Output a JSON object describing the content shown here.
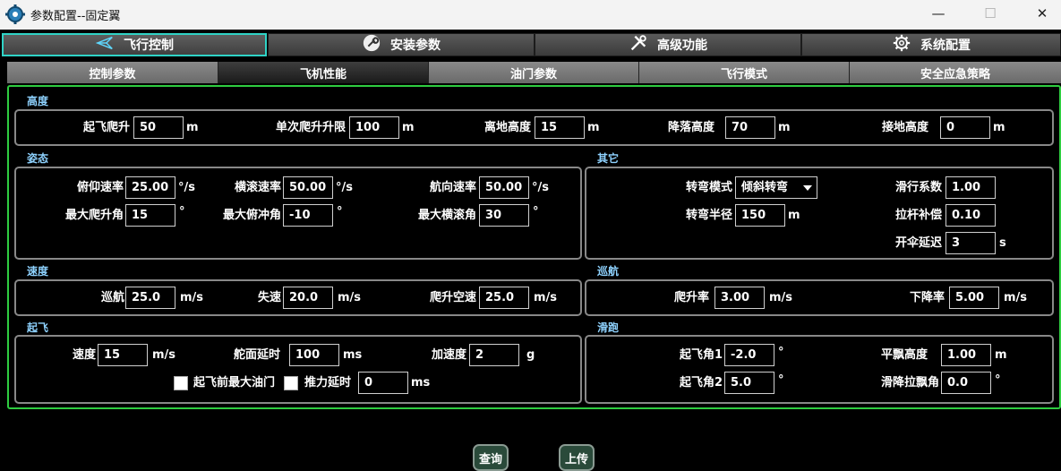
{
  "window": {
    "title": "参数配置--固定翼",
    "minimize": "—",
    "maximize": "☐",
    "close": "✕"
  },
  "main_tabs": [
    {
      "label": "飞行控制",
      "icon": "plane-icon"
    },
    {
      "label": "安装参数",
      "icon": "wrench-icon"
    },
    {
      "label": "高级功能",
      "icon": "tools-icon"
    },
    {
      "label": "系统配置",
      "icon": "gear-icon"
    }
  ],
  "sub_tabs": [
    "控制参数",
    "飞机性能",
    "油门参数",
    "飞行模式",
    "安全应急策略"
  ],
  "altitude": {
    "title": "高度",
    "takeoff_climb": {
      "label": "起飞爬升",
      "value": "50",
      "unit": "m"
    },
    "single_climb_limit": {
      "label": "单次爬升升限",
      "value": "100",
      "unit": "m"
    },
    "ground_clearance": {
      "label": "离地高度",
      "value": "15",
      "unit": "m"
    },
    "landing_height": {
      "label": "降落高度",
      "value": "70",
      "unit": "m"
    },
    "touchdown_height": {
      "label": "接地高度",
      "value": "0",
      "unit": "m"
    }
  },
  "attitude": {
    "title": "姿态",
    "pitch_rate": {
      "label": "俯仰速率",
      "value": "25.00",
      "unit": "°/s"
    },
    "roll_rate": {
      "label": "横滚速率",
      "value": "50.00",
      "unit": "°/s"
    },
    "yaw_rate": {
      "label": "航向速率",
      "value": "50.00",
      "unit": "°/s"
    },
    "max_climb_angle": {
      "label": "最大爬升角",
      "value": "15",
      "unit": "°"
    },
    "max_dive_angle": {
      "label": "最大俯冲角",
      "value": "-10",
      "unit": "°"
    },
    "max_roll_angle": {
      "label": "最大横滚角",
      "value": "30",
      "unit": "°"
    }
  },
  "other": {
    "title": "其它",
    "turn_mode": {
      "label": "转弯模式",
      "value": "倾斜转弯"
    },
    "turn_radius": {
      "label": "转弯半径",
      "value": "150",
      "unit": "m"
    },
    "glide_coef": {
      "label": "滑行系数",
      "value": "1.00"
    },
    "pull_comp": {
      "label": "拉杆补偿",
      "value": "0.10"
    },
    "chute_delay": {
      "label": "开伞延迟",
      "value": "3",
      "unit": "s"
    }
  },
  "speed": {
    "title": "速度",
    "cruise": {
      "label": "巡航",
      "value": "25.0",
      "unit": "m/s"
    },
    "stall": {
      "label": "失速",
      "value": "20.0",
      "unit": "m/s"
    },
    "climb_airspeed": {
      "label": "爬升空速",
      "value": "25.0",
      "unit": "m/s"
    }
  },
  "cruise": {
    "title": "巡航",
    "climb_rate": {
      "label": "爬升率",
      "value": "3.00",
      "unit": "m/s"
    },
    "descent_rate": {
      "label": "下降率",
      "value": "5.00",
      "unit": "m/s"
    }
  },
  "takeoff": {
    "title": "起飞",
    "speed": {
      "label": "速度",
      "value": "15",
      "unit": "m/s"
    },
    "rudder_delay": {
      "label": "舵面延时",
      "value": "100",
      "unit": "ms"
    },
    "accel": {
      "label": "加速度",
      "value": "2",
      "unit": "g"
    },
    "max_throttle_label": "起飞前最大油门",
    "thrust_delay": {
      "label": "推力延时",
      "value": "0",
      "unit": "ms"
    }
  },
  "runway": {
    "title": "滑跑",
    "takeoff_angle1": {
      "label": "起飞角1",
      "value": "-2.0",
      "unit": "°"
    },
    "takeoff_angle2": {
      "label": "起飞角2",
      "value": "5.0",
      "unit": "°"
    },
    "flare_height": {
      "label": "平飘高度",
      "value": "1.00",
      "unit": "m"
    },
    "glide_pull_angle": {
      "label": "滑降拉飘角",
      "value": "0.0",
      "unit": "°"
    }
  },
  "actions": {
    "query": "查询",
    "upload": "上传"
  },
  "colors": {
    "accent_tab": "#2fd3c6",
    "panel_border": "#2ecc40",
    "section_title": "#8ed2ff"
  }
}
